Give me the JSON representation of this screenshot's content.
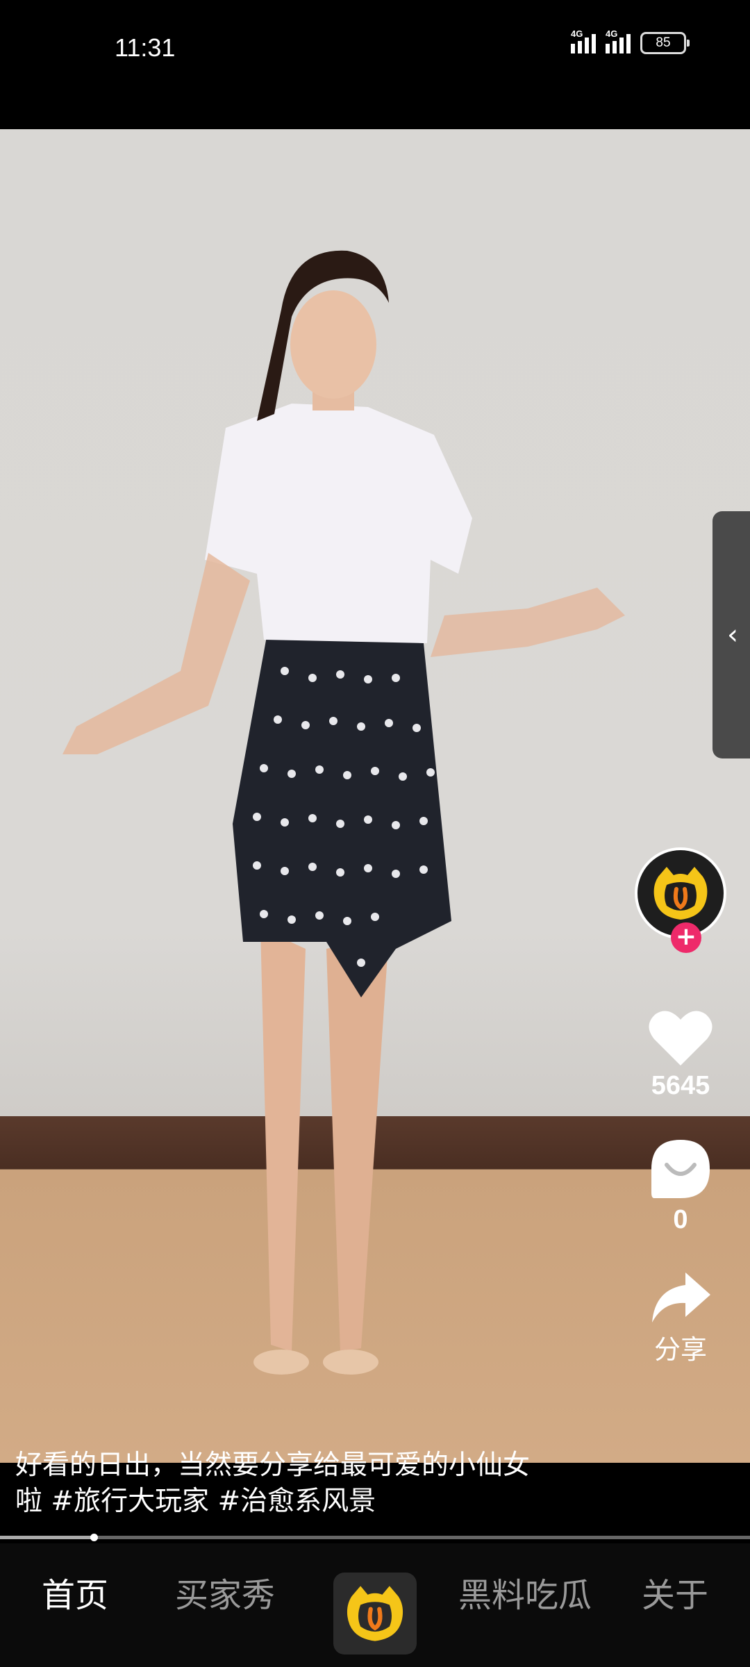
{
  "status_bar": {
    "time": "11:31",
    "network1": "4G",
    "network2": "4G",
    "battery": "85"
  },
  "video": {
    "caption_line1": "好看的日出，当然要分享给最可爱的小仙女",
    "caption_line2": "啦 #旅行大玩家 #治愈系风景",
    "progress_fraction": 0.125
  },
  "actions": {
    "like_count": "5645",
    "comment_count": "0",
    "share_label": "分享",
    "follow_symbol": "+"
  },
  "side_tab": {
    "icon": "chevron-left-icon",
    "glyph": "‹"
  },
  "bottom_nav": {
    "items": [
      {
        "label": "首页"
      },
      {
        "label": "买家秀"
      },
      {
        "label": "黑料吃瓜"
      },
      {
        "label": "关于"
      }
    ],
    "center_icon": "cat-logo-icon"
  },
  "colors": {
    "brand_yellow": "#f5c518",
    "follow_pink": "#ee2a6a"
  }
}
